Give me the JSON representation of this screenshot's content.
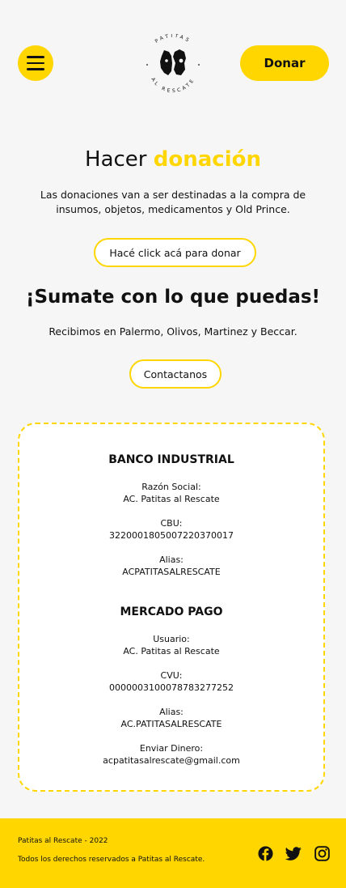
{
  "header": {
    "donate_label": "Donar",
    "logo_top_text": "PATITAS",
    "logo_bottom_text": "AL RESCATE"
  },
  "hero": {
    "title_plain": "Hacer",
    "title_accent": "donación",
    "description": "Las donaciones van a ser destinadas a la compra de insumos, objetos, medicamentos y Old Prince.",
    "donate_link": "Hacé click acá para donar"
  },
  "cta": {
    "title": "¡Sumate con lo que puedas!",
    "received": "Recibimos en Palermo, Olivos, Martinez y Beccar.",
    "contact_label": "Contactanos"
  },
  "banks": [
    {
      "name": "BANCO INDUSTRIAL",
      "fields": [
        {
          "label": "Razón Social:",
          "value": "AC. Patitas al Rescate"
        },
        {
          "label": "CBU:",
          "value": "3220001805007220370017"
        },
        {
          "label": "Alias:",
          "value": "ACPATITASALRESCATE"
        }
      ]
    },
    {
      "name": "MERCADO PAGO",
      "fields": [
        {
          "label": "Usuario:",
          "value": "AC. Patitas al Rescate"
        },
        {
          "label": "CVU:",
          "value": "0000003100078783277252"
        },
        {
          "label": "Alias:",
          "value": "AC.PATITASALRESCATE"
        },
        {
          "label": "Enviar Dinero:",
          "value": "acpatitasalrescate@gmail.com"
        }
      ]
    }
  ],
  "footer": {
    "copyright": "Patitas al Rescate - 2022",
    "rights": "Todos los derechos reservados a Patitas al Rescate.",
    "icons": [
      "facebook-icon",
      "twitter-icon",
      "instagram-icon"
    ]
  },
  "colors": {
    "accent": "#ffd600",
    "background": "#f6f6f6",
    "text": "#111111"
  }
}
